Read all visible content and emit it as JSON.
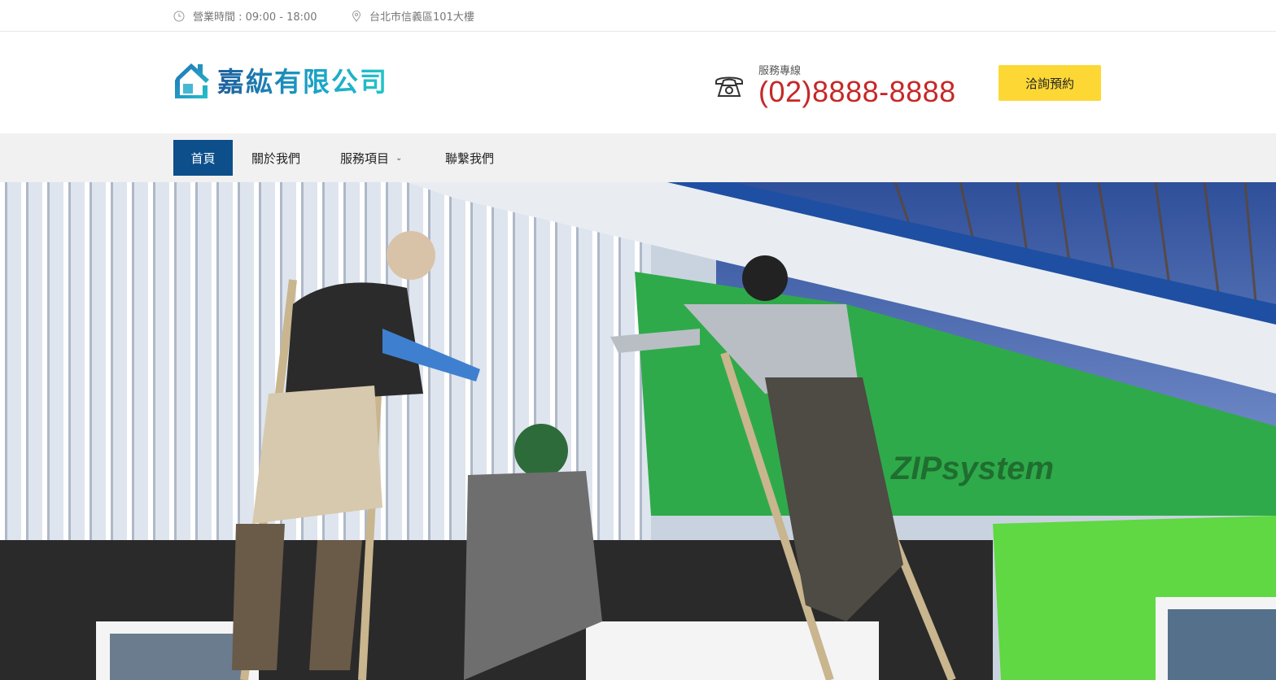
{
  "topbar": {
    "hours": "營業時間 : 09:00 - 18:00",
    "address": "台北市信義區101大樓",
    "hours_icon": "clock-icon",
    "address_icon": "map-pin-icon"
  },
  "header": {
    "logo_text": "嘉紘有限公司",
    "logo_icon": "house-logo-icon",
    "phone_label": "服務專線",
    "phone_number": "(02)8888-8888",
    "phone_icon": "telephone-icon",
    "cta_label": "洽詢預約"
  },
  "nav": {
    "items": [
      {
        "label": "首頁",
        "active": true
      },
      {
        "label": "關於我們",
        "active": false
      },
      {
        "label": "服務項目",
        "active": false,
        "has_dropdown": true
      },
      {
        "label": "聯繫我們",
        "active": false
      }
    ]
  },
  "hero": {
    "image": "workers-installing-metal-siding-photo",
    "sheathing_text": "ZIPsystem"
  },
  "colors": {
    "nav_active": "#0d4f8b",
    "cta": "#fdd835",
    "phone": "#c62828",
    "nav_bg": "#f1f1f1"
  }
}
